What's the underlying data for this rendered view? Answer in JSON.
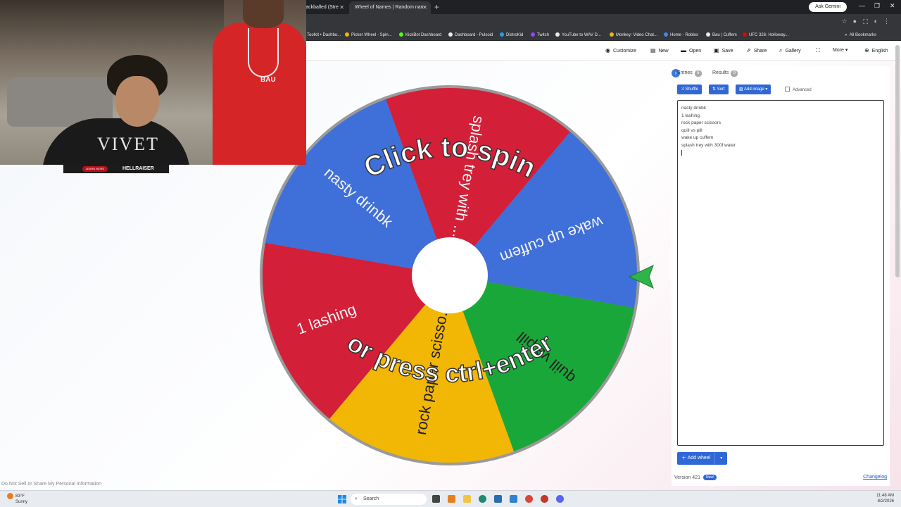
{
  "browser": {
    "tabs": [
      {
        "label": "Blackballed (Stre"
      },
      {
        "label": "Wheel of Names | Random nam"
      }
    ],
    "gemini": "Ask Gemini",
    "bookmarks": [
      "Toolkit • Dashbo...",
      "Picker Wheel - Spin...",
      "KickBot Dashboard",
      "Dashboard - Pulsoid",
      "DistroKid",
      "Twitch",
      "YouTube to WAV D...",
      "Monkey: Video Chat...",
      "Home - Roblox",
      "Bau | Cuffem",
      "UFC 326: Holloway..."
    ],
    "all_bookmarks": "All Bookmarks"
  },
  "nav": {
    "customize": "Customize",
    "new": "New",
    "open": "Open",
    "save": "Save",
    "share": "Share",
    "gallery": "Gallery",
    "more": "More",
    "language": "English"
  },
  "wheel": {
    "spin_line1": "Click to spin",
    "spin_line2": "or press ctrl+enter",
    "colors": {
      "red": "#d31f38",
      "blue": "#3f6fd9",
      "green": "#1aa73a",
      "yellow": "#f2b705"
    },
    "segments": [
      {
        "label": "splash trey with ...",
        "color": "red"
      },
      {
        "label": "wake up cuffem",
        "color": "blue"
      },
      {
        "label": "quill vs pill",
        "color": "green"
      },
      {
        "label": "rock paper scisso...",
        "color": "yellow"
      },
      {
        "label": "1 lashing",
        "color": "red"
      },
      {
        "label": "nasty drinbk",
        "color": "blue"
      }
    ]
  },
  "panel": {
    "entries_tab": "Entries",
    "entries_count": "6",
    "results_tab": "Results",
    "results_count": "0",
    "shuffle": "Shuffle",
    "sort": "Sort",
    "add_image": "Add image",
    "advanced": "Advanced",
    "entries": [
      "nasty drinbk",
      "1 lashing",
      "rock paper scissors",
      "quill vs pill",
      "wake up cuffem",
      "splash trey with 300f water"
    ],
    "add_wheel": "Add wheel",
    "version": "Version 421",
    "new_badge": "New!",
    "changelog": "Changelog"
  },
  "footer": {
    "dns": "Do Not Sell or Share My Personal Information"
  },
  "stream": {
    "shirt_text": "VIVET",
    "pendant": "BAU",
    "ad_learn": "LEARN MORE",
    "ad_brand": "HELLRAISER"
  },
  "taskbar": {
    "temp": "83°F",
    "weather": "Sunny",
    "search": "Search",
    "time": "11:48 AM",
    "date": "8/2/2026"
  }
}
